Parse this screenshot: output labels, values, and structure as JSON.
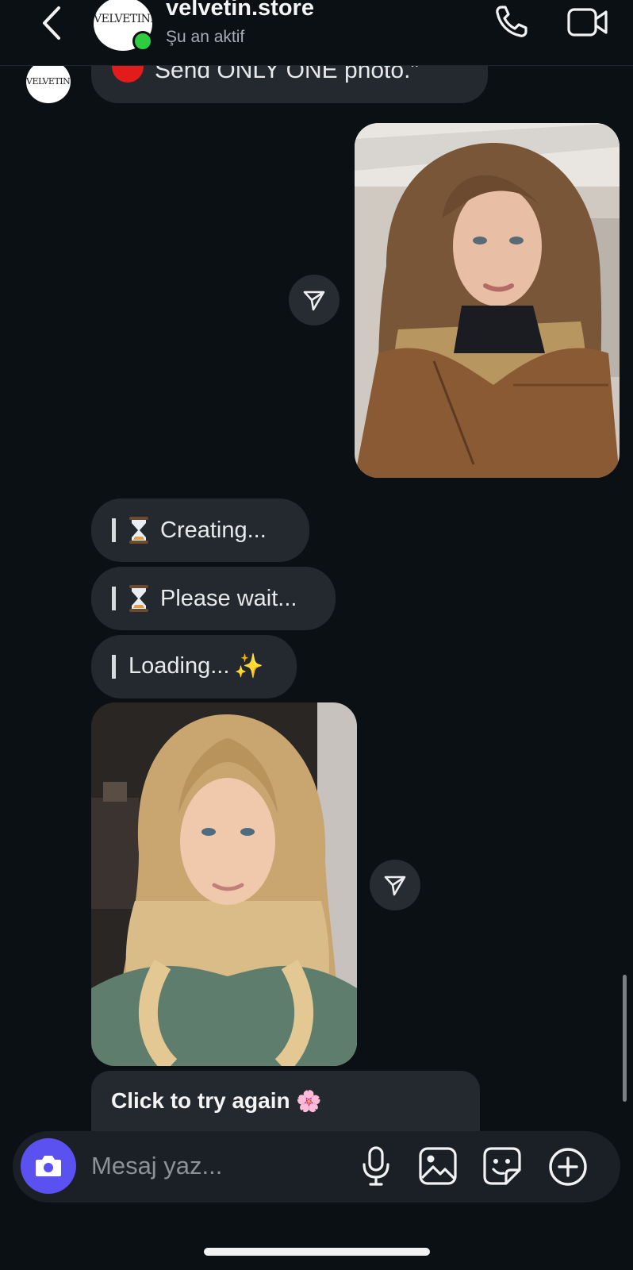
{
  "header": {
    "contact_name": "velvetin.store",
    "status": "Şu an aktif",
    "avatar_logo": "VELVETINE"
  },
  "messages": {
    "top_partial": "Send ONLY ONE photo.\"",
    "creating": "Creating...",
    "please_wait": "Please wait...",
    "loading": "Loading...",
    "sparkles": "✨",
    "retry": "Click to try again",
    "flower": "🌸"
  },
  "composer": {
    "placeholder": "Mesaj yaz..."
  },
  "colors": {
    "background": "#0b1014",
    "incoming_bubble": "#24292f",
    "camera_button": "#5b51f0",
    "online": "#2ecc40"
  },
  "icons": [
    "back-icon",
    "call-icon",
    "video-icon",
    "share-icon",
    "camera-icon",
    "mic-icon",
    "gallery-icon",
    "sticker-icon",
    "plus-icon"
  ]
}
